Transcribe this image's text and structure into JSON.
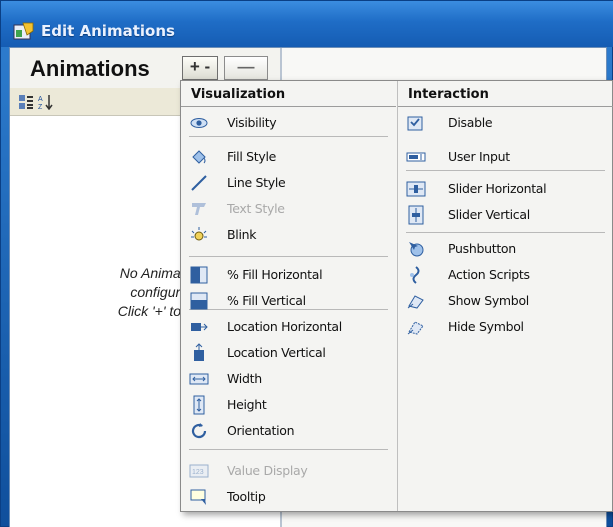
{
  "window": {
    "title": "Edit Animations"
  },
  "panel": {
    "heading": "Animations",
    "add_label": "+ -",
    "remove_label": "—",
    "empty_message_1": "No Animations",
    "empty_message_2": "configured.",
    "empty_message_3": "Click '+' to add."
  },
  "menu": {
    "visualization_header": "Visualization",
    "interaction_header": "Interaction",
    "visualization_items": [
      {
        "label": "Visibility",
        "icon": "eye-icon",
        "enabled": true
      },
      {
        "label": "Fill Style",
        "icon": "paint-bucket-icon",
        "enabled": true
      },
      {
        "label": "Line Style",
        "icon": "line-icon",
        "enabled": true
      },
      {
        "label": "Text Style",
        "icon": "text-style-icon",
        "enabled": false
      },
      {
        "label": "Blink",
        "icon": "blink-icon",
        "enabled": true
      },
      {
        "label": "% Fill Horizontal",
        "icon": "fill-horizontal-icon",
        "enabled": true
      },
      {
        "label": "% Fill Vertical",
        "icon": "fill-vertical-icon",
        "enabled": true
      },
      {
        "label": "Location Horizontal",
        "icon": "location-horizontal-icon",
        "enabled": true
      },
      {
        "label": "Location Vertical",
        "icon": "location-vertical-icon",
        "enabled": true
      },
      {
        "label": "Width",
        "icon": "width-icon",
        "enabled": true
      },
      {
        "label": "Height",
        "icon": "height-icon",
        "enabled": true
      },
      {
        "label": "Orientation",
        "icon": "orientation-icon",
        "enabled": true
      },
      {
        "label": "Value Display",
        "icon": "value-display-icon",
        "enabled": false
      },
      {
        "label": "Tooltip",
        "icon": "tooltip-icon",
        "enabled": true
      }
    ],
    "interaction_items": [
      {
        "label": "Disable",
        "icon": "disable-icon",
        "enabled": true
      },
      {
        "label": "User Input",
        "icon": "user-input-icon",
        "enabled": true
      },
      {
        "label": "Slider Horizontal",
        "icon": "slider-horizontal-icon",
        "enabled": true
      },
      {
        "label": "Slider Vertical",
        "icon": "slider-vertical-icon",
        "enabled": true
      },
      {
        "label": "Pushbutton",
        "icon": "pushbutton-icon",
        "enabled": true
      },
      {
        "label": "Action Scripts",
        "icon": "action-scripts-icon",
        "enabled": true
      },
      {
        "label": "Show Symbol",
        "icon": "show-symbol-icon",
        "enabled": true
      },
      {
        "label": "Hide Symbol",
        "icon": "hide-symbol-icon",
        "enabled": true
      }
    ]
  },
  "colors": {
    "titlebar": "#1f6dc6",
    "menu_bg": "#f4f4f2",
    "icon_blue": "#2f5fa0",
    "disabled_text": "#a9a9a9"
  }
}
